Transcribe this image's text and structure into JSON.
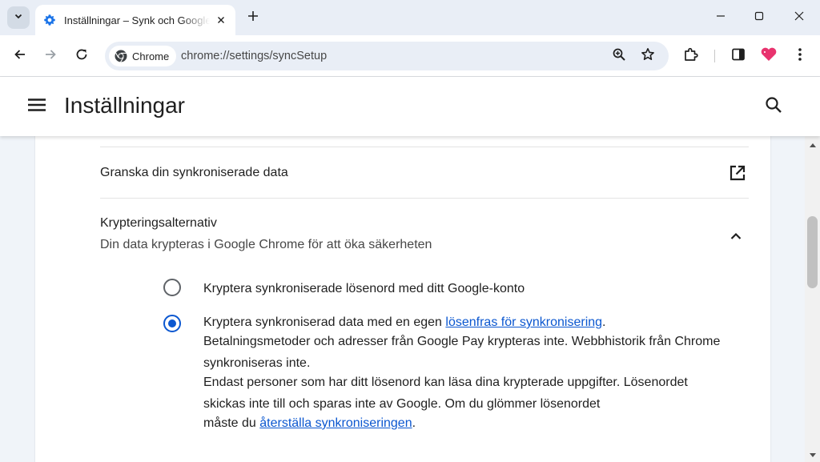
{
  "browser": {
    "tab": {
      "title": "Inställningar – Synk och Google-tjänster",
      "favicon": "gear-icon"
    },
    "omnibox": {
      "chip_label": "Chrome",
      "url": "chrome://settings/syncSetup"
    },
    "icons": [
      "chevron-down-icon",
      "plus-icon",
      "minimize-icon",
      "maximize-icon",
      "close-icon",
      "back-arrow-icon",
      "forward-arrow-icon",
      "reload-icon",
      "zoom-icon",
      "star-icon",
      "extensions-icon",
      "side-panel-icon",
      "heart-icon",
      "more-vert-icon"
    ],
    "colors": {
      "tabstrip": "#e9eef6",
      "accent": "#0b57d0",
      "heart": "#e8336e"
    }
  },
  "settings": {
    "header": {
      "title": "Inställningar"
    },
    "review": {
      "label": "Granska din synkroniserade data"
    },
    "encryption": {
      "title": "Krypteringsalternativ",
      "subtitle": "Din data krypteras i Google Chrome för att öka säkerheten",
      "option1": {
        "label": "Kryptera synkroniserade lösenord med ditt Google-konto",
        "selected": false
      },
      "option2": {
        "selected": true,
        "line1_before": "Kryptera synkroniserad data med en egen ",
        "line1_link": "lösenfras för synkronisering",
        "line1_after": ".",
        "line2": "Betalningsmetoder och adresser från Google Pay krypteras inte. Webbhistorik från Chrome synkroniseras inte.",
        "line3": "Endast personer som har ditt lösenord kan läsa dina krypterade uppgifter. Lösenordet skickas inte till och sparas inte av Google. Om du glömmer lösenordet",
        "line4_before": "måste du ",
        "line4_link": "återställa synkroniseringen",
        "line4_after": "."
      }
    }
  }
}
